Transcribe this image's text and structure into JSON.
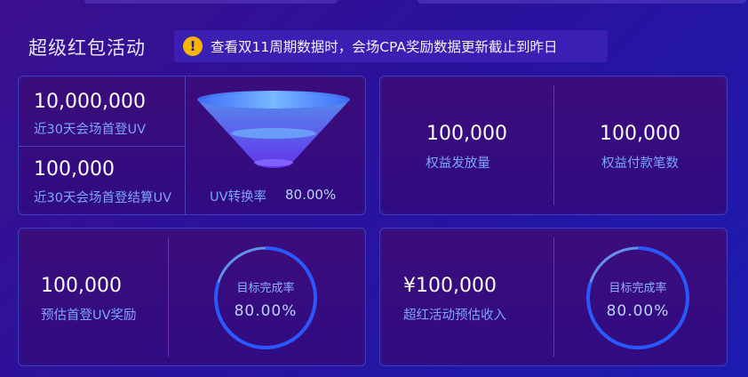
{
  "header": {
    "title": "超级红包活动",
    "notice": "查看双11周期数据时，会场CPA奖励数据更新截止到昨日"
  },
  "card1": {
    "uv_value": "10,000,000",
    "uv_label": "近30天会场首登UV",
    "settle_value": "100,000",
    "settle_label": "近30天会场首登结算UV",
    "conversion_label": "UV转换率",
    "conversion_value": "80.00%"
  },
  "card2": {
    "issued_value": "100,000",
    "issued_label": "权益发放量",
    "paid_value": "100,000",
    "paid_label": "权益付款笔数"
  },
  "card3": {
    "reward_value": "100,000",
    "reward_label": "预估首登UV奖励",
    "target_label": "目标完成率",
    "target_value": "80.00%",
    "progress": 0.8
  },
  "card4": {
    "income_value": "¥100,000",
    "income_label": "超红活动预估收入",
    "target_label": "目标完成率",
    "target_value": "80.00%",
    "progress": 0.8
  },
  "colors": {
    "accent": "#4f7cff",
    "warning": "#f7b500",
    "label": "#7fa4ff"
  },
  "icons": {
    "notice": "warning-icon",
    "funnel": "funnel-icon",
    "ring": "progress-ring"
  }
}
